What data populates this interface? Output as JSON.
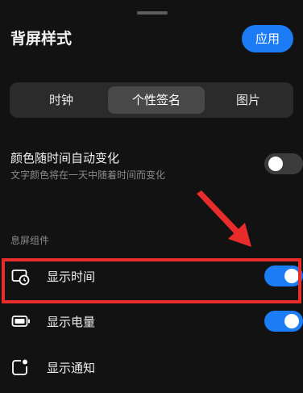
{
  "header": {
    "title": "背屏样式",
    "apply_label": "应用"
  },
  "segment": {
    "tabs": [
      {
        "label": "时钟",
        "active": false
      },
      {
        "label": "个性签名",
        "active": true
      },
      {
        "label": "图片",
        "active": false
      }
    ]
  },
  "color_change": {
    "title": "颜色随时间自动变化",
    "subtitle": "文字颜色将在一天中随着时间而变化",
    "enabled": false
  },
  "widgets": {
    "section_label": "息屏组件",
    "items": [
      {
        "label": "显示时间",
        "icon": "screen-clock-icon",
        "enabled": true
      },
      {
        "label": "显示电量",
        "icon": "battery-icon",
        "enabled": true
      },
      {
        "label": "显示通知",
        "icon": "notification-icon",
        "enabled": null
      }
    ]
  },
  "colors": {
    "accent": "#1b7cf5",
    "highlight": "#e82b2b",
    "background": "#121212"
  }
}
